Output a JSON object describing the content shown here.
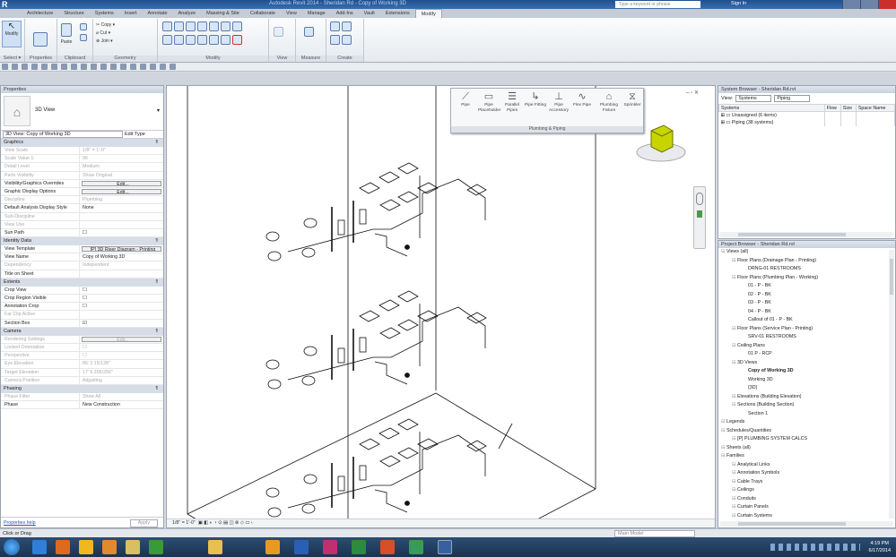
{
  "titlebar": {
    "app_letter": "R",
    "title": "Autodesk Revit 2014 - Sheridan Rd - Copy of Working 3D",
    "search_placeholder": "Type a keyword or phrase",
    "signin": "Sign In"
  },
  "ribbon": {
    "tabs": [
      "Architecture",
      "Structure",
      "Systems",
      "Insert",
      "Annotate",
      "Analyze",
      "Massing & Site",
      "Collaborate",
      "View",
      "Manage",
      "Add-Ins",
      "Vault",
      "Extensions",
      "Modify"
    ],
    "active_tab": "Modify",
    "panels": [
      "Select ▾",
      "Properties",
      "Clipboard",
      "Geometry",
      "Modify",
      "View",
      "Measure",
      "Create"
    ],
    "buttons": {
      "modify": "Modify",
      "paste": "Paste",
      "copy": "Copy",
      "cut": "Cut",
      "join": "Join"
    }
  },
  "properties": {
    "header": "Properties",
    "type_name": "3D View",
    "instance_selector": "3D View: Copy of Working 3D",
    "edit_type": "Edit Type",
    "groups": [
      {
        "name": "Graphics",
        "rows": [
          {
            "k": "View Scale",
            "v": "1/8\" = 1'-0\"",
            "dim": true
          },
          {
            "k": "Scale Value    1:",
            "v": "96",
            "dim": true
          },
          {
            "k": "Detail Level",
            "v": "Medium",
            "dim": true
          },
          {
            "k": "Parts Visibility",
            "v": "Show Original",
            "dim": true
          },
          {
            "k": "Visibility/Graphics Overrides",
            "v": "Edit...",
            "btn": true
          },
          {
            "k": "Graphic Display Options",
            "v": "Edit...",
            "btn": true
          },
          {
            "k": "Discipline",
            "v": "Plumbing",
            "dim": true
          },
          {
            "k": "Default Analysis Display Style",
            "v": "None"
          },
          {
            "k": "Sub-Discipline",
            "v": "",
            "dim": true
          },
          {
            "k": "View Use",
            "v": "",
            "dim": true
          },
          {
            "k": "Sun Path",
            "v": "☐"
          }
        ]
      },
      {
        "name": "Identity Data",
        "rows": [
          {
            "k": "View Template",
            "v": "[P] 3D Riser Diagram - Printing",
            "btn": true
          },
          {
            "k": "View Name",
            "v": "Copy of Working 3D"
          },
          {
            "k": "Dependency",
            "v": "Independent",
            "dim": true
          },
          {
            "k": "Title on Sheet",
            "v": ""
          }
        ]
      },
      {
        "name": "Extents",
        "rows": [
          {
            "k": "Crop View",
            "v": "☐"
          },
          {
            "k": "Crop Region Visible",
            "v": "☐"
          },
          {
            "k": "Annotation Crop",
            "v": "☐"
          },
          {
            "k": "Far Clip Active",
            "v": "",
            "dim": true
          },
          {
            "k": "Section Box",
            "v": "☑"
          }
        ]
      },
      {
        "name": "Camera",
        "rows": [
          {
            "k": "Rendering Settings",
            "v": "Edit...",
            "btn": true,
            "dim": true
          },
          {
            "k": "Locked Orientation",
            "v": "☐",
            "dim": true
          },
          {
            "k": "Perspective",
            "v": "☐",
            "dim": true
          },
          {
            "k": "Eye Elevation",
            "v": "86' 2 15/128\"",
            "dim": true
          },
          {
            "k": "Target Elevation",
            "v": "17' 6 295/256\"",
            "dim": true
          },
          {
            "k": "Camera Position",
            "v": "Adjusting",
            "dim": true
          }
        ]
      },
      {
        "name": "Phasing",
        "rows": [
          {
            "k": "Phase Filter",
            "v": "Show All",
            "dim": true
          },
          {
            "k": "Phase",
            "v": "New Construction"
          }
        ]
      }
    ],
    "help_link": "Properties help",
    "apply": "Apply"
  },
  "flyout": {
    "buttons": [
      "Pipe",
      "Pipe Placeholder",
      "Parallel Pipes",
      "Pipe Fitting",
      "Pipe Accessory",
      "Flex Pipe",
      "Plumbing Fixture",
      "Sprinkler"
    ],
    "label": "Plumbing & Piping"
  },
  "view_control": {
    "scale": "1/8\" = 1'-0\""
  },
  "system_browser": {
    "title": "System Browser - Sheridan Rd.rvt",
    "view_label": "View:",
    "view_value": "Systems",
    "filter_value": "Piping",
    "columns": [
      "Systems",
      "Flow",
      "Size",
      "Space Name"
    ],
    "rows": [
      "Unassigned (6 items)",
      "Piping (38 systems)"
    ]
  },
  "project_browser": {
    "title": "Project Browser - Sheridan Rd.rvt",
    "items": [
      {
        "t": "Views (all)",
        "l": 0
      },
      {
        "t": "Floor Plans (Drainage Plan - Printing)",
        "l": 1
      },
      {
        "t": "DRNG-01 RESTROOMS",
        "l": 2
      },
      {
        "t": "Floor Plans (Plumbing Plan - Working)",
        "l": 1
      },
      {
        "t": "01 - P - BK",
        "l": 2
      },
      {
        "t": "02 - P - BK",
        "l": 2
      },
      {
        "t": "03 - P - BK",
        "l": 2
      },
      {
        "t": "04 - P - BK",
        "l": 2
      },
      {
        "t": "Callout of 01 - P - BK",
        "l": 2
      },
      {
        "t": "Floor Plans (Service Plan - Printing)",
        "l": 1
      },
      {
        "t": "SRV-01 RESTROOMS",
        "l": 2
      },
      {
        "t": "Ceiling Plans",
        "l": 1
      },
      {
        "t": "01 P - RCP",
        "l": 2
      },
      {
        "t": "3D Views",
        "l": 1
      },
      {
        "t": "Copy of Working 3D",
        "l": 2,
        "bold": true
      },
      {
        "t": "Working 3D",
        "l": 2
      },
      {
        "t": "{3D}",
        "l": 2
      },
      {
        "t": "Elevations (Building Elevation)",
        "l": 1
      },
      {
        "t": "Sections (Building Section)",
        "l": 1
      },
      {
        "t": "Section 1",
        "l": 2
      },
      {
        "t": "Legends",
        "l": 0
      },
      {
        "t": "Schedules/Quantities",
        "l": 0
      },
      {
        "t": "[P] PLUMBING SYSTEM CALCS",
        "l": 1
      },
      {
        "t": "Sheets (all)",
        "l": 0
      },
      {
        "t": "Families",
        "l": 0
      },
      {
        "t": "Analytical Links",
        "l": 1
      },
      {
        "t": "Annotation Symbols",
        "l": 1
      },
      {
        "t": "Cable Trays",
        "l": 1
      },
      {
        "t": "Ceilings",
        "l": 1
      },
      {
        "t": "Conduits",
        "l": 1
      },
      {
        "t": "Curtain Panels",
        "l": 1
      },
      {
        "t": "Curtain Systems",
        "l": 1
      }
    ]
  },
  "status": {
    "text": "Click or Drag",
    "model": "Main Model"
  },
  "clock": {
    "time": "4:19 PM",
    "date": "6/17/2014"
  },
  "colors": {
    "accent": "#2a5fa5",
    "viewcube": "#c8d400"
  }
}
